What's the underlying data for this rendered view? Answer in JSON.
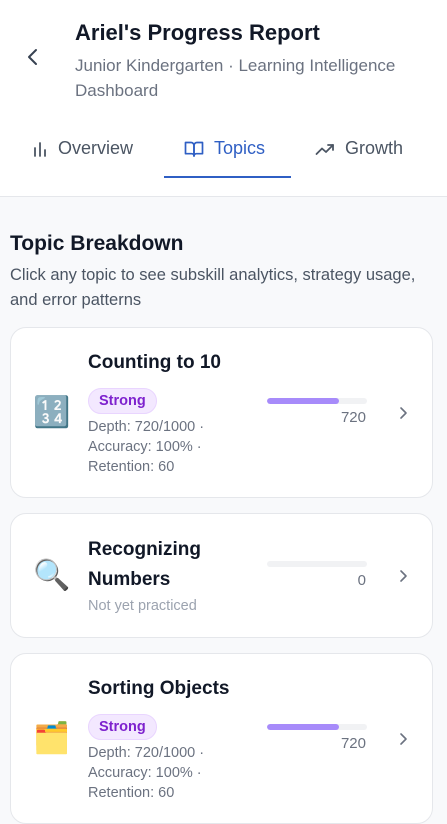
{
  "header": {
    "title": "Ariel's Progress Report",
    "subtitle": "Junior Kindergarten · Learning Intelligence Dashboard"
  },
  "tabs": [
    {
      "label": "Overview",
      "icon": "bar-chart-icon",
      "active": false
    },
    {
      "label": "Topics",
      "icon": "book-open-icon",
      "active": true
    },
    {
      "label": "Growth",
      "icon": "trending-up-icon",
      "active": false
    }
  ],
  "section": {
    "title": "Topic Breakdown",
    "description": "Click any topic to see subskill analytics, strategy usage, and error patterns"
  },
  "colors": {
    "accent": "#2f5fc4",
    "bar": "#a78bfa",
    "badge_bg": "#f3e8ff",
    "badge_text": "#7e22ce"
  },
  "topics": [
    {
      "emoji": "🔢",
      "icon": "numbers-icon",
      "name": "Counting to 10",
      "badge": "Strong",
      "depth": "Depth: 720/1000 ·",
      "accuracy": "Accuracy: 100% ·",
      "retention": "Retention: 60",
      "score": "720",
      "progress": 0.72
    },
    {
      "emoji": "🔍",
      "icon": "magnifier-icon",
      "name": "Recognizing Numbers",
      "status": "Not yet practiced",
      "score": "0",
      "progress": 0
    },
    {
      "emoji": "🗂️",
      "icon": "folder-icon",
      "name": "Sorting Objects",
      "badge": "Strong",
      "depth": "Depth: 720/1000 ·",
      "accuracy": "Accuracy: 100% ·",
      "retention": "Retention: 60",
      "score": "720",
      "progress": 0.72
    }
  ]
}
